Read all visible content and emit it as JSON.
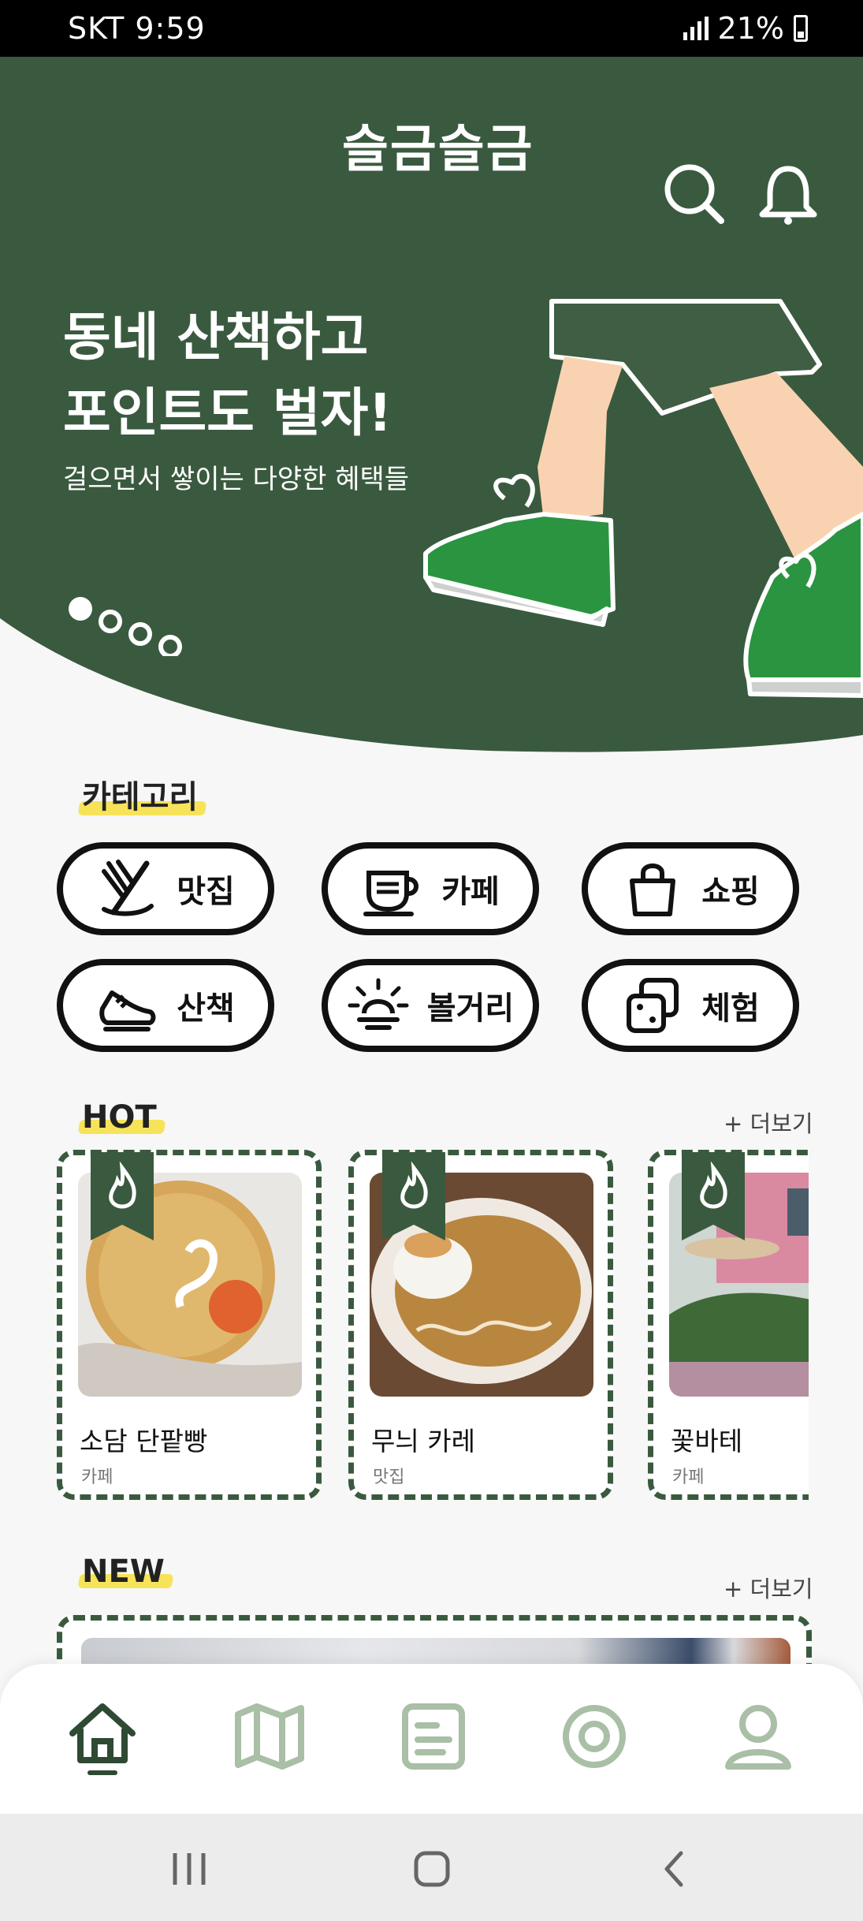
{
  "status_bar": {
    "carrier_time": "SKT 9:59",
    "battery": "21%"
  },
  "header": {
    "title": "슬금슬금",
    "search_icon": "search-icon",
    "bell_icon": "bell-icon"
  },
  "hero": {
    "headline": "동네 산책하고\n포인트도 벌자!",
    "subline": "걸으면서 쌓이는 다양한 혜택들",
    "total_slides": 4,
    "active_slide": 1
  },
  "categories": {
    "title": "카테고리",
    "items": [
      {
        "label": "맛집",
        "icon": "utensils-icon"
      },
      {
        "label": "카페",
        "icon": "coffee-cup-icon"
      },
      {
        "label": "쇼핑",
        "icon": "shopping-bag-icon"
      },
      {
        "label": "산책",
        "icon": "sneaker-icon"
      },
      {
        "label": "볼거리",
        "icon": "sunrise-icon"
      },
      {
        "label": "체험",
        "icon": "dice-icon"
      }
    ]
  },
  "hot": {
    "title": "HOT",
    "more": "+ 더보기",
    "items": [
      {
        "name": "소담 단팥빵",
        "category": "카페"
      },
      {
        "name": "무늬 카레",
        "category": "맛집"
      },
      {
        "name": "꽃바테",
        "category": "카페"
      }
    ]
  },
  "new": {
    "title": "NEW",
    "more": "+ 더보기"
  },
  "tab_bar": {
    "tabs": [
      {
        "icon": "home-icon",
        "active": true
      },
      {
        "icon": "map-icon",
        "active": false
      },
      {
        "icon": "list-card-icon",
        "active": false
      },
      {
        "icon": "camera-lens-icon",
        "active": false
      },
      {
        "icon": "profile-icon",
        "active": false
      }
    ]
  },
  "colors": {
    "brand_green": "#3a5a3f",
    "shoe_green": "#2a9440",
    "highlight_yellow": "#f7e35a",
    "tab_inactive": "#a9bfa6"
  }
}
